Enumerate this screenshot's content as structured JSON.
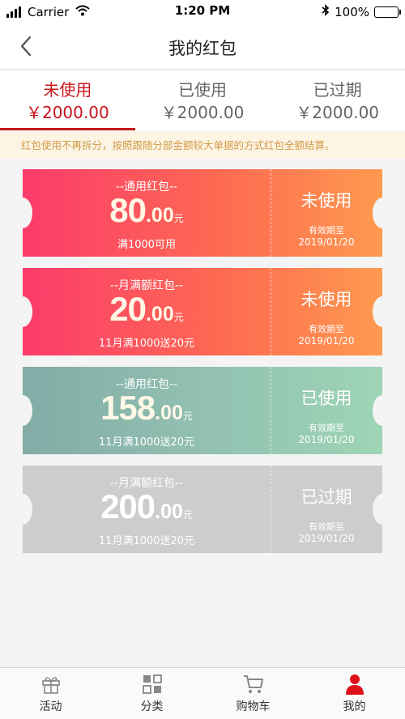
{
  "status_bar": {
    "carrier": "Carrier",
    "time": "1:20 PM",
    "battery": "100%"
  },
  "nav": {
    "title": "我的红包"
  },
  "tabs": [
    {
      "label": "未使用",
      "amount": "￥2000.00",
      "active": true
    },
    {
      "label": "已使用",
      "amount": "￥2000.00",
      "active": false
    },
    {
      "label": "已过期",
      "amount": "￥2000.00",
      "active": false
    }
  ],
  "notice": "红包使用不再拆分，按照跟随分部金额较大单据的方式红包全额结算。",
  "coupons": [
    {
      "type": "--通用红包--",
      "value_int": "80",
      "value_dec": ".00",
      "unit": "元",
      "condition": "满1000可用",
      "status": "未使用",
      "expiry_label": "有效期至",
      "expiry_date": "2019/01/20",
      "style": "red"
    },
    {
      "type": "--月满额红包--",
      "value_int": "20",
      "value_dec": ".00",
      "unit": "元",
      "condition": "11月满1000送20元",
      "status": "未使用",
      "expiry_label": "有效期至",
      "expiry_date": "2019/01/20",
      "style": "red"
    },
    {
      "type": "--通用红包--",
      "value_int": "158",
      "value_dec": ".00",
      "unit": "元",
      "condition": "11月满1000送20元",
      "status": "已使用",
      "expiry_label": "有效期至",
      "expiry_date": "2019/01/20",
      "style": "green"
    },
    {
      "type": "--月满额红包--",
      "value_int": "200",
      "value_dec": ".00",
      "unit": "元",
      "condition": "11月满1000送20元",
      "status": "已过期",
      "expiry_label": "有效期至",
      "expiry_date": "2019/01/20",
      "style": "gray"
    }
  ],
  "tab_bar": [
    {
      "label": "活动",
      "icon": "gift-icon",
      "active": false
    },
    {
      "label": "分类",
      "icon": "category-grid-icon",
      "active": false
    },
    {
      "label": "购物车",
      "icon": "cart-icon",
      "active": false
    },
    {
      "label": "我的",
      "icon": "user-icon",
      "active": true
    }
  ],
  "colors": {
    "accent": "#c8161d",
    "notice_bg": "#fdf5e3",
    "notice_text": "#d19a4a",
    "coupon_red_start": "#fb3b6b",
    "coupon_red_end": "#fe9a4f",
    "coupon_green_start": "#82aca6",
    "coupon_green_end": "#9ed5b5",
    "coupon_gray": "#cdcdcd"
  }
}
